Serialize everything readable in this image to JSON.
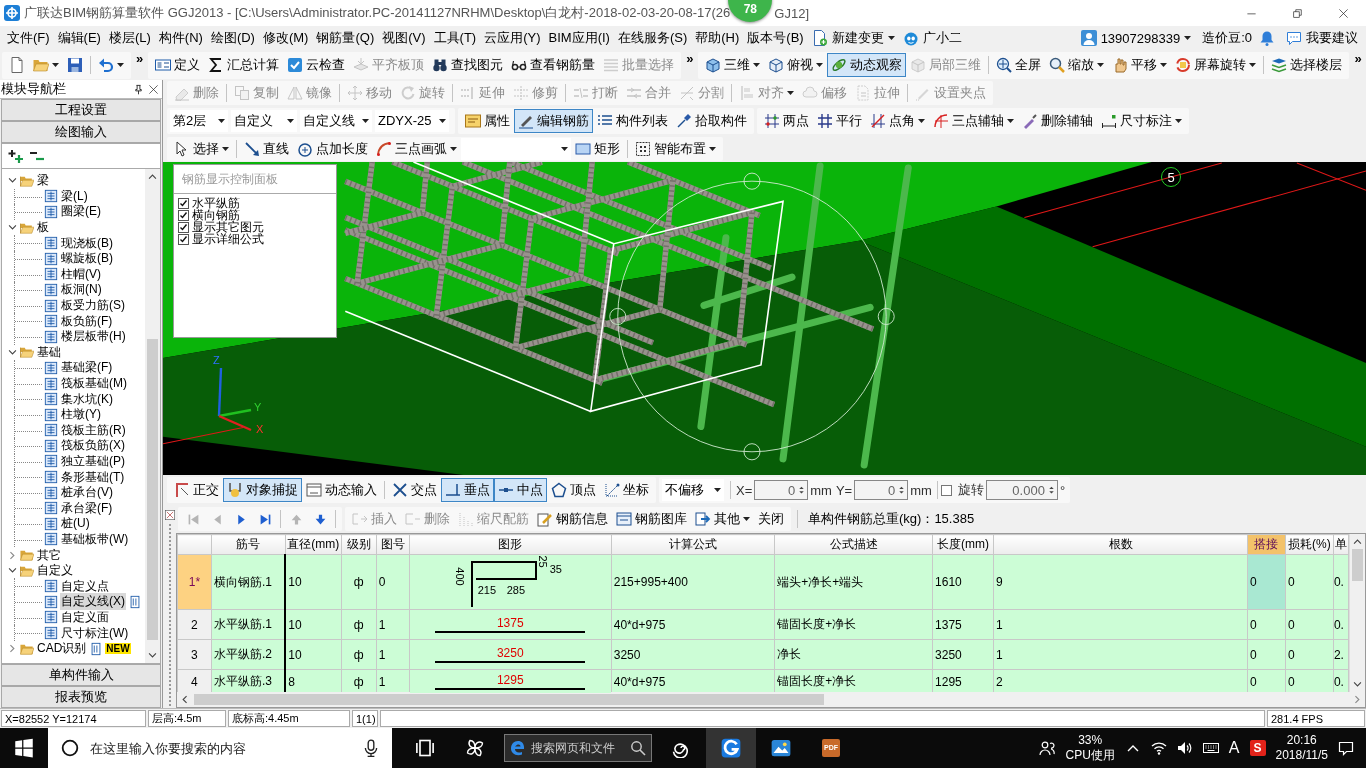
{
  "window": {
    "title": "广联达BIM钢筋算量软件 GGJ2013 - [C:\\Users\\Administrator.PC-20141127NRHM\\Desktop\\白龙村-2018-02-03-20-08-17(26",
    "badge": "78",
    "title_tail": "GJ12]"
  },
  "menu_bar": {
    "items": [
      "文件(F)",
      "编辑(E)",
      "楼层(L)",
      "构件(N)",
      "绘图(D)",
      "修改(M)",
      "钢筋量(Q)",
      "视图(V)",
      "工具(T)",
      "云应用(Y)",
      "BIM应用(I)",
      "在线服务(S)",
      "帮助(H)",
      "版本号(B)"
    ],
    "extras": [
      {
        "label": "新建变更",
        "dropdown": true
      },
      {
        "label": "广小二",
        "dropdown": false
      }
    ],
    "account": {
      "user": "13907298339",
      "beans": "造价豆:0",
      "feedback": "我要建议"
    }
  },
  "main_toolbar": {
    "bands": [
      {
        "sections": [
          [
            {
              "dropdown": false
            },
            {
              "dropdown": true
            },
            {
              "dropdown": false
            }
          ],
          [
            {
              "dropdown": true
            }
          ]
        ],
        "overflow": "»"
      },
      {
        "sections": [
          [
            {
              "label": "定义",
              "disabled": false
            },
            {
              "label": "汇总计算",
              "disabled": false
            },
            {
              "label": "云检查",
              "disabled": false
            },
            {
              "label": "平齐板顶",
              "disabled": true
            },
            {
              "label": "查找图元",
              "disabled": false
            },
            {
              "label": "查看钢筋量",
              "disabled": false
            },
            {
              "label": "批量选择",
              "disabled": true
            }
          ]
        ],
        "overflow": "»"
      },
      {
        "sections": [
          [
            {
              "label": "三维",
              "dropdown": true,
              "selected": false,
              "disabled": false
            },
            {
              "label": "俯视",
              "dropdown": true,
              "selected": false,
              "disabled": false
            },
            {
              "label": "动态观察",
              "dropdown": false,
              "selected": true,
              "disabled": false
            },
            {
              "label": "局部三维",
              "dropdown": false,
              "selected": false,
              "disabled": true
            }
          ],
          [
            {
              "label": "全屏",
              "dropdown": false
            },
            {
              "label": "缩放",
              "dropdown": true
            },
            {
              "label": "平移",
              "dropdown": true
            },
            {
              "label": "屏幕旋转",
              "dropdown": true
            }
          ],
          [
            {
              "label": "选择楼层",
              "dropdown": false
            }
          ]
        ],
        "overflow": "»"
      }
    ]
  },
  "navigator": {
    "title": "模块导航栏",
    "top_buttons": [
      "工程设置",
      "绘图输入"
    ],
    "tree": [
      {
        "label": "梁",
        "expanded": true,
        "selected": false,
        "children": [
          {
            "label": "梁(L)",
            "selected": false
          },
          {
            "label": "圈梁(E)",
            "selected": false
          }
        ]
      },
      {
        "label": "板",
        "expanded": true,
        "selected": false,
        "children": [
          {
            "label": "现浇板(B)",
            "selected": false
          },
          {
            "label": "螺旋板(B)",
            "selected": false
          },
          {
            "label": "柱帽(V)",
            "selected": false
          },
          {
            "label": "板洞(N)",
            "selected": false
          },
          {
            "label": "板受力筋(S)",
            "selected": false
          },
          {
            "label": "板负筋(F)",
            "selected": false
          },
          {
            "label": "楼层板带(H)",
            "selected": false
          }
        ]
      },
      {
        "label": "基础",
        "expanded": true,
        "selected": false,
        "children": [
          {
            "label": "基础梁(F)",
            "selected": false
          },
          {
            "label": "筏板基础(M)",
            "selected": false
          },
          {
            "label": "集水坑(K)",
            "selected": false
          },
          {
            "label": "柱墩(Y)",
            "selected": false
          },
          {
            "label": "筏板主筋(R)",
            "selected": false
          },
          {
            "label": "筏板负筋(X)",
            "selected": false
          },
          {
            "label": "独立基础(P)",
            "selected": false
          },
          {
            "label": "条形基础(T)",
            "selected": false
          },
          {
            "label": "桩承台(V)",
            "selected": false
          },
          {
            "label": "承台梁(F)",
            "selected": false
          },
          {
            "label": "桩(U)",
            "selected": false
          },
          {
            "label": "基础板带(W)",
            "selected": false
          }
        ]
      },
      {
        "label": "其它",
        "expanded": false,
        "selected": false
      },
      {
        "label": "自定义",
        "expanded": true,
        "selected": false,
        "children": [
          {
            "label": "自定义点",
            "selected": false
          },
          {
            "label": "自定义线(X)",
            "selected": true
          },
          {
            "label": "自定义面",
            "selected": false
          },
          {
            "label": "尺寸标注(W)",
            "selected": false
          }
        ]
      },
      {
        "label": "CAD识别",
        "expanded": false,
        "selected": false,
        "tag": "NEW"
      }
    ],
    "bottom_buttons": [
      "单构件输入",
      "报表预览"
    ]
  },
  "edit_toolbar": {
    "bands": [
      {
        "sections": [
          [
            {
              "label": "删除",
              "disabled": true
            }
          ],
          [
            {
              "label": "复制",
              "disabled": true
            },
            {
              "label": "镜像",
              "disabled": true
            }
          ],
          [
            {
              "label": "移动",
              "disabled": true
            },
            {
              "label": "旋转",
              "disabled": true
            }
          ],
          [
            {
              "label": "延伸",
              "disabled": true
            },
            {
              "label": "修剪",
              "disabled": true
            }
          ],
          [
            {
              "label": "打断",
              "disabled": true
            },
            {
              "label": "合并",
              "disabled": true
            },
            {
              "label": "分割",
              "disabled": true
            }
          ],
          [
            {
              "label": "对齐",
              "disabled": true,
              "dropdown": true
            },
            {
              "label": "偏移",
              "disabled": true,
              "dropdown": false
            },
            {
              "label": "拉伸",
              "disabled": true,
              "dropdown": false
            }
          ],
          [
            {
              "label": "设置夹点",
              "disabled": true
            }
          ]
        ]
      }
    ]
  },
  "layer_toolbar": {
    "selects": [
      "第2层",
      "自定义",
      "自定义线",
      "ZDYX-25"
    ],
    "bands": [
      {
        "sections": [
          [
            {
              "label": "属性",
              "selected": false
            },
            {
              "label": "编辑钢筋",
              "selected": true
            },
            {
              "label": "构件列表",
              "selected": false
            },
            {
              "label": "拾取构件",
              "selected": false
            }
          ]
        ]
      },
      {
        "sections": [
          [
            {
              "label": "两点",
              "dropdown": false
            },
            {
              "label": "平行",
              "dropdown": false
            },
            {
              "label": "点角",
              "dropdown": true
            },
            {
              "label": "三点辅轴",
              "dropdown": true
            },
            {
              "label": "删除辅轴",
              "dropdown": false
            },
            {
              "label": "尺寸标注",
              "dropdown": true
            }
          ]
        ]
      }
    ]
  },
  "draw_toolbar": {
    "bands": [
      {
        "sections": [
          [
            {
              "label": "选择",
              "dropdown": true
            }
          ],
          [
            {
              "kind": "button",
              "label": "直线",
              "dropdown": false
            },
            {
              "kind": "button",
              "label": "点加长度",
              "dropdown": false
            },
            {
              "kind": "button",
              "label": "三点画弧",
              "dropdown": true
            },
            {
              "kind": "select"
            },
            {
              "kind": "button",
              "label": "矩形",
              "dropdown": false
            }
          ],
          [
            {
              "label": "智能布置",
              "dropdown": true
            }
          ]
        ]
      }
    ]
  },
  "viewport": {
    "panel": {
      "title": "钢筋显示控制面板",
      "items": [
        {
          "label": "水平纵筋",
          "checked": true
        },
        {
          "label": "横向钢筋",
          "checked": true
        },
        {
          "label": "显示其它图元",
          "checked": true
        },
        {
          "label": "显示详细公式",
          "checked": true
        }
      ]
    },
    "marker": "5",
    "axes": [
      "Z",
      "Y",
      "X"
    ]
  },
  "snap_toolbar": {
    "bands": [
      {
        "sections": [
          [
            {
              "label": "正交",
              "selected": false
            },
            {
              "label": "对象捕捉",
              "selected": true
            },
            {
              "label": "动态输入",
              "selected": false
            }
          ],
          [
            {
              "label": "交点",
              "selected": false
            },
            {
              "label": "垂点",
              "selected": true
            },
            {
              "label": "中点",
              "selected": true
            },
            {
              "label": "顶点",
              "selected": false
            },
            {
              "label": "坐标",
              "selected": false
            }
          ]
        ]
      }
    ],
    "offset": "不偏移",
    "x_label": "X=",
    "x_value": "0",
    "x_unit": "mm",
    "y_label": "Y=",
    "y_value": "0",
    "y_unit": "mm",
    "rotate": {
      "checked": false,
      "label": "旋转",
      "value": "0.000",
      "unit": "°"
    }
  },
  "rebar_toolbar": {
    "nav": [
      {
        "disabled": true
      },
      {
        "disabled": true
      },
      {
        "disabled": false
      },
      {
        "disabled": false
      }
    ],
    "move": [
      {
        "disabled": true
      },
      {
        "disabled": false
      }
    ],
    "bands": [
      {
        "sections": [
          [
            {
              "label": "插入",
              "disabled": true,
              "dropdown": false
            },
            {
              "label": "删除",
              "disabled": true,
              "dropdown": false
            },
            {
              "label": "缩尺配筋",
              "disabled": true,
              "dropdown": false
            },
            {
              "label": "钢筋信息",
              "disabled": false,
              "dropdown": false
            },
            {
              "label": "钢筋图库",
              "disabled": false,
              "dropdown": false
            },
            {
              "label": "其他",
              "disabled": false,
              "dropdown": true
            },
            {
              "label": "关闭",
              "disabled": false,
              "dropdown": false
            }
          ]
        ]
      }
    ],
    "total": "单构件钢筋总重(kg)：15.385"
  },
  "rebar_table": {
    "columns": [
      {
        "label": "筋号",
        "selected": false
      },
      {
        "label": "直径(mm)",
        "selected": false
      },
      {
        "label": "级别",
        "selected": false
      },
      {
        "label": "图号",
        "selected": false
      },
      {
        "label": "图形",
        "selected": false
      },
      {
        "label": "计算公式",
        "selected": false
      },
      {
        "label": "公式描述",
        "selected": false
      },
      {
        "label": "长度(mm)",
        "selected": false
      },
      {
        "label": "根数",
        "selected": false
      },
      {
        "label": "搭接",
        "selected": true
      },
      {
        "label": "损耗(%)",
        "selected": false
      },
      {
        "label": "单",
        "selected": false
      }
    ],
    "rows": [
      {
        "index": "1*",
        "selected": true,
        "name": "横向钢筋.1",
        "diameter": "10",
        "grade": "ф",
        "figure": "0",
        "shape": {
          "kind": "bent",
          "labels": [
            "400",
            "215",
            "285",
            "25",
            "35"
          ]
        },
        "formula": "215+995+400",
        "description": "端头+净长+端头",
        "length": "1610",
        "count": "9",
        "lap": "0",
        "loss": "0",
        "unit_weight": "0."
      },
      {
        "index": "2",
        "selected": false,
        "name": "水平纵筋.1",
        "diameter": "10",
        "grade": "ф",
        "figure": "1",
        "shape": {
          "kind": "straight",
          "label": "1375"
        },
        "formula": "40*d+975",
        "description": "锚固长度+净长",
        "length": "1375",
        "count": "1",
        "lap": "0",
        "loss": "0",
        "unit_weight": "0."
      },
      {
        "index": "3",
        "selected": false,
        "name": "水平纵筋.2",
        "diameter": "10",
        "grade": "ф",
        "figure": "1",
        "shape": {
          "kind": "straight",
          "label": "3250"
        },
        "formula": "3250",
        "description": "净长",
        "length": "3250",
        "count": "1",
        "lap": "0",
        "loss": "0",
        "unit_weight": "2."
      },
      {
        "index": "4",
        "selected": false,
        "name": "水平纵筋.3",
        "diameter": "8",
        "grade": "ф",
        "figure": "1",
        "shape": {
          "kind": "straight",
          "label": "1295"
        },
        "formula": "40*d+975",
        "description": "锚固长度+净长",
        "length": "1295",
        "count": "2",
        "lap": "0",
        "loss": "0",
        "unit_weight": "0."
      }
    ]
  },
  "status_bar": {
    "fields": [
      "X=82552 Y=12174",
      "层高:4.5m",
      "底标高:4.45m",
      "1(1)"
    ],
    "fps": "281.4 FPS"
  },
  "taskbar": {
    "search": {
      "placeholder": "在这里输入你要搜索的内容"
    },
    "web_search": {
      "placeholder": "搜索网页和文件"
    },
    "pdf_icon_text": "PDF",
    "cpu": {
      "value": "33%",
      "label": "CPU使用"
    },
    "ime": "A",
    "ime_badge": "S",
    "clock": {
      "time": "20:16",
      "date": "2018/11/5"
    }
  }
}
